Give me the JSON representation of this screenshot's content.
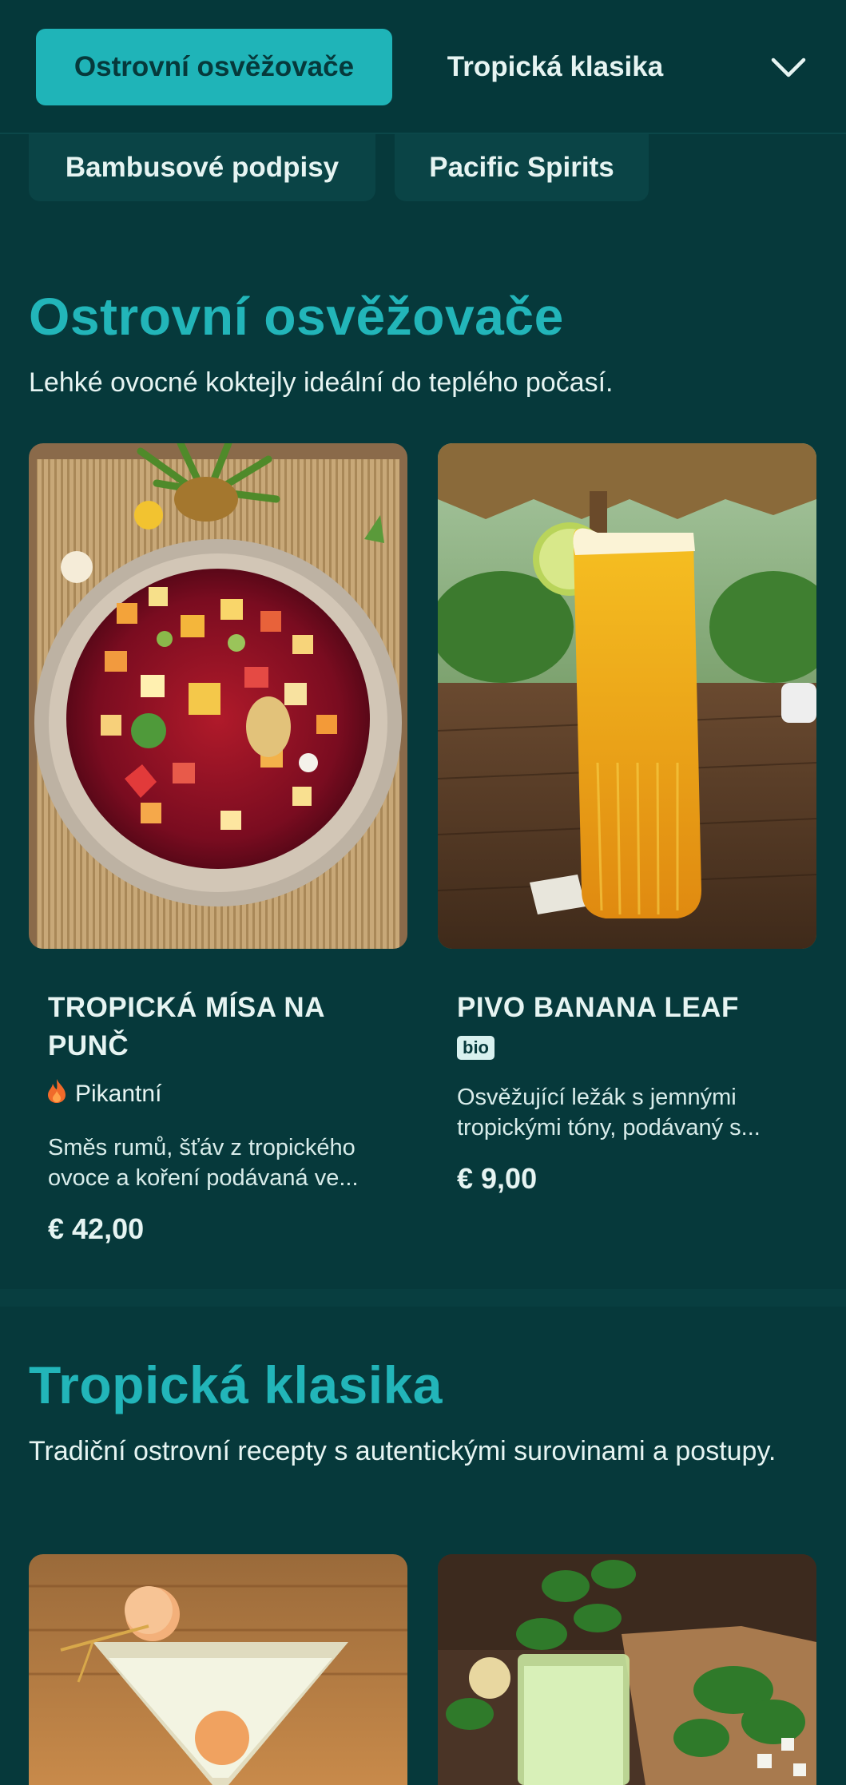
{
  "nav": {
    "tabs": [
      {
        "label": "Ostrovní osvěžovače",
        "active": true
      },
      {
        "label": "Tropická klasika",
        "active": false
      }
    ],
    "more_tabs": [
      "Bambusové podpisy",
      "Pacific Spirits"
    ],
    "expand_icon": "chevron-down-icon"
  },
  "sections": [
    {
      "title": "Ostrovní osvěžovače",
      "description": "Lehké ovocné koktejly ideální do teplého počasí.",
      "items": [
        {
          "name": "TROPICKÁ MÍSA NA PUNČ",
          "tag": "Pikantní",
          "tag_icon": "flame-icon",
          "description": "Směs rumů, šťáv z tropického ovoce a koření podávaná ve...",
          "price": "€ 42,00"
        },
        {
          "name": "PIVO BANANA LEAF",
          "badge": "bio",
          "description": "Osvěžující ležák s jemnými tropickými tóny, podávaný s...",
          "price": "€ 9,00"
        }
      ]
    },
    {
      "title": "Tropická klasika",
      "description": "Tradiční ostrovní recepty s autentickými surovinami a postupy.",
      "items": []
    }
  ],
  "colors": {
    "background": "#06393b",
    "accent": "#1fb4b8",
    "text": "#e6f4f2",
    "flame": "#f06a2a"
  }
}
